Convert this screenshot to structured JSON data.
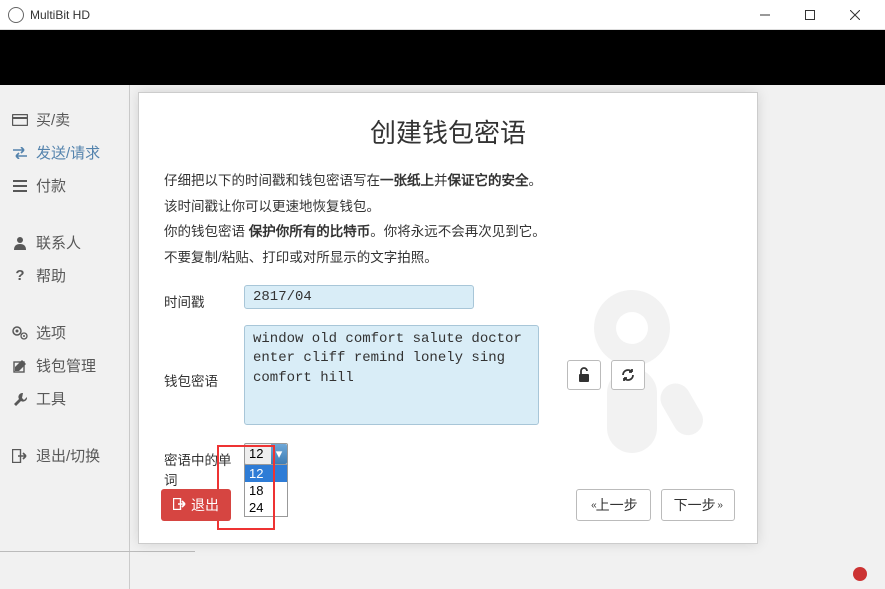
{
  "titlebar": {
    "title": "MultiBit HD"
  },
  "sidebar": {
    "groups": [
      {
        "label": "买/卖",
        "icon": "card"
      },
      {
        "label": "发送/请求",
        "icon": "exchange"
      },
      {
        "label": "付款",
        "icon": "list"
      }
    ],
    "groups2": [
      {
        "label": "联系人",
        "icon": "user"
      },
      {
        "label": "帮助",
        "icon": "question"
      }
    ],
    "groups3": [
      {
        "label": "选项",
        "icon": "gears"
      },
      {
        "label": "钱包管理",
        "icon": "edit"
      },
      {
        "label": "工具",
        "icon": "wrench"
      }
    ],
    "groups4": [
      {
        "label": "退出/切换",
        "icon": "signout"
      }
    ]
  },
  "modal": {
    "title": "创建钱包密语",
    "line1a": "仔细把以下的时间戳和钱包密语写在",
    "line1b": "一张纸上",
    "line1c": "并",
    "line1d": "保证它的安全",
    "line1e": "。",
    "line2": "该时间戳让你可以更速地恢复钱包。",
    "line3a": "你的钱包密语",
    "line3b": " 保护你所有的比特币",
    "line3c": "。你将永远不会再次见到它。",
    "line4": "不要复制/粘贴、打印或对所显示的文字拍照。",
    "label_timestamp": "时间戳",
    "timestamp_value": "2817/04",
    "label_seed": "钱包密语",
    "seed_value": "window old comfort salute doctor enter cliff remind lonely sing comfort hill",
    "label_words": "密语中的单词",
    "words_selected": "12",
    "words_options": [
      "12",
      "18",
      "24"
    ],
    "btn_exit": "退出",
    "btn_prev": "上一步",
    "btn_next": "下一步"
  }
}
